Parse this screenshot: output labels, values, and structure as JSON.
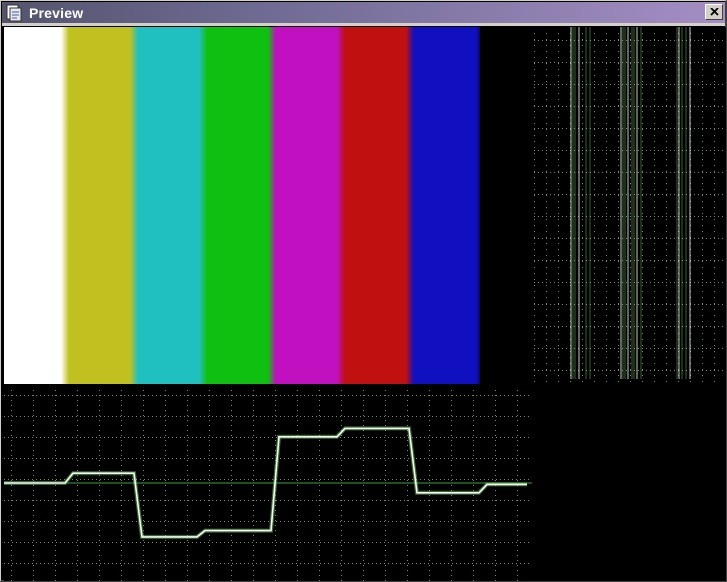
{
  "window": {
    "title": "Preview",
    "icon": "document-icon",
    "close_icon": "close-icon"
  },
  "color_bars": {
    "colors": [
      "#ffffff",
      "#c0c020",
      "#20c0c0",
      "#10c010",
      "#c010c0",
      "#c01010",
      "#1010c0",
      "#000000"
    ]
  },
  "scope_colors": {
    "grid": "#6f8f6f",
    "trace": "#f0fff0",
    "glow": "#7ac86a",
    "baseline": "#3aa040"
  },
  "waveform": {
    "levels": [
      0.0,
      0.14,
      -0.77,
      -0.68,
      0.66,
      0.78,
      -0.14,
      -0.02
    ]
  }
}
